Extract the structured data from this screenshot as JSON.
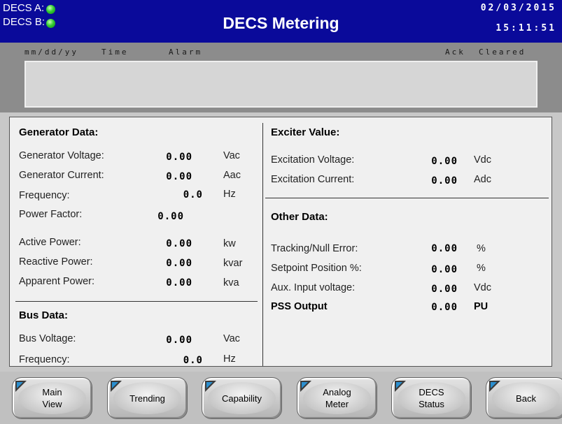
{
  "header": {
    "decs_a_label": "DECS A:",
    "decs_b_label": "DECS B:",
    "title": "DECS Metering",
    "date": "02/03/2015",
    "time": "15:11:51",
    "status_color": "#33cc33"
  },
  "alarm": {
    "col_date": "mm/dd/yy",
    "col_time": "Time",
    "col_alarm": "Alarm",
    "col_ack": "Ack",
    "col_cleared": "Cleared"
  },
  "generator": {
    "title": "Generator Data:",
    "rows": [
      {
        "label": "Generator Voltage:",
        "value": "0.00",
        "unit": "Vac"
      },
      {
        "label": "Generator Current:",
        "value": "0.00",
        "unit": "Aac"
      },
      {
        "label": "Frequency:",
        "value": "0.0",
        "unit": "Hz"
      },
      {
        "label": "Power Factor:",
        "value": "0.00",
        "unit": ""
      },
      {
        "label": "Active Power:",
        "value": "0.00",
        "unit": "kw"
      },
      {
        "label": "Reactive Power:",
        "value": "0.00",
        "unit": "kvar"
      },
      {
        "label": "Apparent Power:",
        "value": "0.00",
        "unit": "kva"
      }
    ]
  },
  "bus": {
    "title": "Bus Data:",
    "rows": [
      {
        "label": "Bus Voltage:",
        "value": "0.00",
        "unit": "Vac"
      },
      {
        "label": "Frequency:",
        "value": "0.0",
        "unit": "Hz"
      }
    ]
  },
  "exciter": {
    "title": "Exciter Value:",
    "rows": [
      {
        "label": "Excitation Voltage:",
        "value": "0.00",
        "unit": "Vdc"
      },
      {
        "label": "Excitation Current:",
        "value": "0.00",
        "unit": "Adc"
      }
    ]
  },
  "other": {
    "title": "Other Data:",
    "rows": [
      {
        "label": "Tracking/Null Error:",
        "value": "0.00",
        "unit": "%"
      },
      {
        "label": "Setpoint Position %:",
        "value": "0.00",
        "unit": "%"
      },
      {
        "label": "Aux. Input voltage:",
        "value": "0.00",
        "unit": "Vdc"
      },
      {
        "label": "PSS Output",
        "value": "0.00",
        "unit": "PU"
      }
    ]
  },
  "nav": {
    "main_view": "Main\nView",
    "trending": "Trending",
    "capability": "Capability",
    "analog_meter": "Analog\nMeter",
    "decs_status": "DECS\nStatus",
    "back": "Back"
  }
}
